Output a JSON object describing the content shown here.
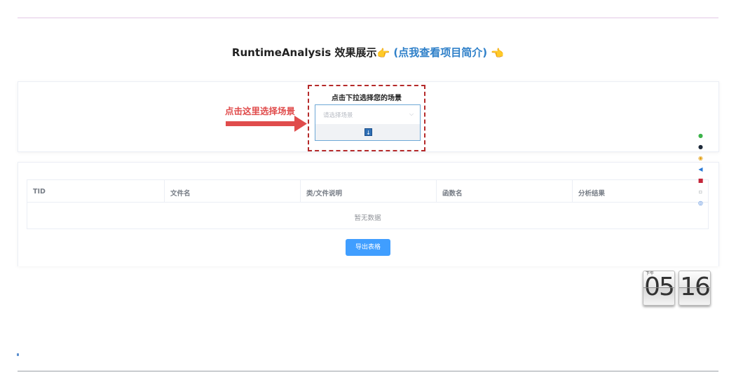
{
  "header": {
    "title_main": "RuntimeAnalysis 效果展示",
    "title_link": "(点我查看项目简介)",
    "hand_right_icon": "👉",
    "hand_left_icon": "👈"
  },
  "scene_picker": {
    "hint": "点击这里选择场景",
    "label": "点击下拉选择您的场景",
    "select_placeholder": "请选择场景",
    "chevron": "⌵",
    "download_icon": "↓"
  },
  "table": {
    "columns": [
      "TID",
      "文件名",
      "类/文件说明",
      "函数名",
      "分析结果"
    ],
    "empty_text": "暂无数据"
  },
  "export_button": "导出表格",
  "clock": {
    "hour": "05",
    "minute": "16",
    "ampm": "下午"
  },
  "colors": {
    "accent": "#409eff",
    "hint": "#e04c4c",
    "link": "#2f80c9",
    "dashed_border": "#b52a2a"
  },
  "tray_icons": [
    "wechat-icon",
    "mail-icon",
    "chrome-icon",
    "vscode-icon",
    "app-icon",
    "image-icon",
    "network-icon"
  ]
}
